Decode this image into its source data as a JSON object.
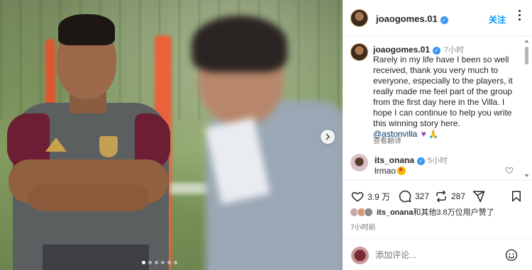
{
  "post": {
    "username": "joaogomes.01",
    "follow_label": "关注",
    "caption_time": "7小时",
    "caption_text": "Rarely in my life have I been so well received, thank you very much to everyone, especially to the players, it really made me feel part of the group from the first day here in the Villa. I hope I can continue to help you write this winning story here.",
    "mention": "@astonvilla",
    "see_translation": "查看翻译",
    "like_count": "3.9 万",
    "comment_count": "327",
    "repost_count": "287",
    "liked_by_user": "its_onana",
    "liked_by_rest": "和其他3.8万位用户赞了",
    "post_time": "7小时前",
    "add_comment_placeholder": "添加评论..."
  },
  "comments": [
    {
      "username": "its_onana",
      "time": "5小时",
      "text": "lrmao"
    }
  ],
  "colors": {
    "link": "#0095f6",
    "verified": "#3897f0",
    "mention": "#00376b"
  },
  "icons": [
    "verified-badge-icon",
    "more-options-icon",
    "heart-icon",
    "comment-icon",
    "repost-icon",
    "send-icon",
    "bookmark-icon",
    "emoji-icon",
    "next-arrow-icon"
  ]
}
